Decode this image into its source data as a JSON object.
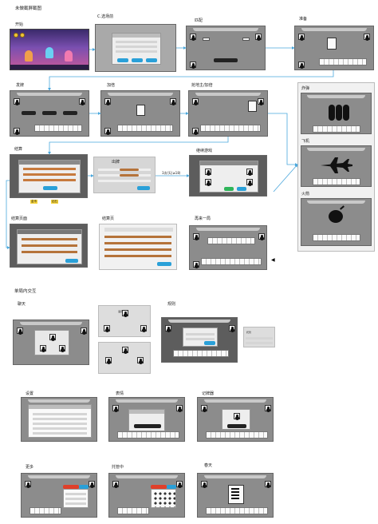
{
  "page_title": "未做截屏截图",
  "section2_title": "单局内交互",
  "labels": {
    "start": "开始",
    "select_field": "C.选场前",
    "match": "匹配",
    "ready": "准备",
    "deal": "发牌",
    "double": "加倍",
    "grab": "抢地主/加倍",
    "settle": "结算",
    "play_cards": "出牌",
    "result_a": "结算页面",
    "result_b": "结算页",
    "continue": "继续游戏",
    "replay": "再来一局",
    "explode_panel": "特效",
    "chat": "聊天",
    "voice": "语音",
    "rules": "规则",
    "trustee": "托管",
    "settings": "设置",
    "emoji": "表情",
    "record": "记牌器",
    "more": "更多",
    "deposit": "托管中",
    "bomb": "炸弹",
    "plane": "飞机",
    "rocket": "火箭",
    "spring": "春天",
    "exit": "离开"
  },
  "tags": {
    "yellow1": "金币",
    "yellow2": "钻石"
  },
  "side_note": "3次/天(≥18)",
  "icons": [
    "avatar-icon",
    "card-icon",
    "close-icon",
    "bomb-icon",
    "plane-icon",
    "rocket-icon",
    "arrow-icon"
  ],
  "colors": {
    "connector": "#4aa7dc",
    "button_blue": "#2aa0d8",
    "button_brown": "#b5733a",
    "button_green": "#2fb55a",
    "screen_gray": "#8c8c8c",
    "screen_dark": "#5d5d5d"
  }
}
